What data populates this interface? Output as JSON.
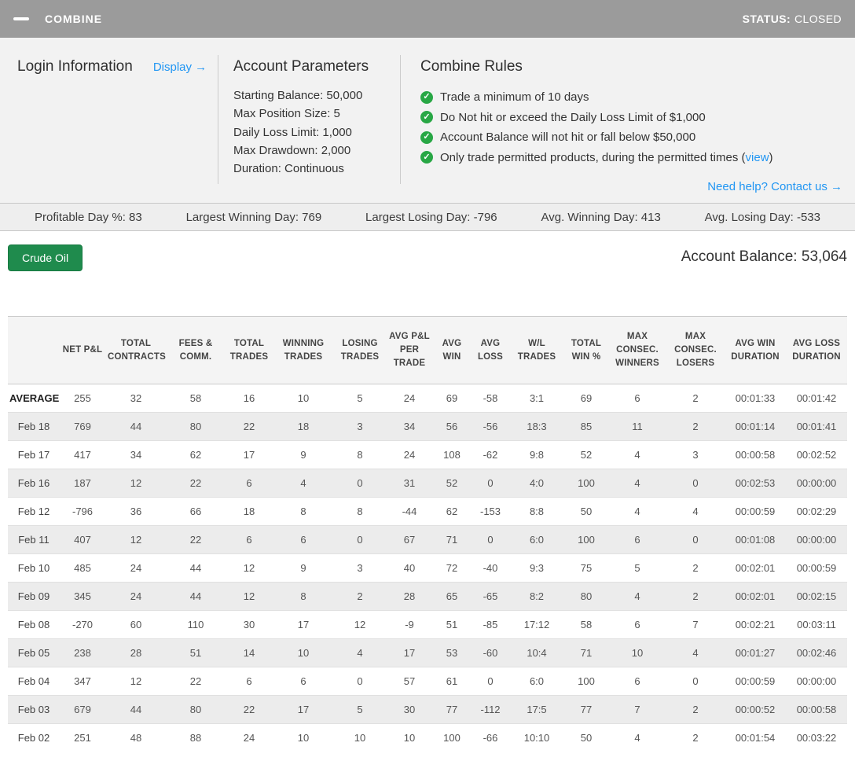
{
  "colors": {
    "topbar_gray": "#9b9b9b",
    "link_blue": "#2196f3",
    "check_green": "#28a745",
    "button_green": "#1f8b4d"
  },
  "header": {
    "title": "COMBINE",
    "status_label": "STATUS:",
    "status_value": "CLOSED"
  },
  "login": {
    "title": "Login Information",
    "display_link": "Display →"
  },
  "account_parameters": {
    "title": "Account Parameters",
    "items": [
      "Starting Balance: 50,000",
      "Max Position Size: 5",
      "Daily Loss Limit: 1,000",
      "Max Drawdown: 2,000",
      "Duration: Continuous"
    ]
  },
  "combine_rules": {
    "title": "Combine Rules",
    "rules": [
      {
        "prefix": "Trade a minimum of 10 days",
        "link": "",
        "suffix": ""
      },
      {
        "prefix": "Do Not hit or exceed the Daily Loss Limit of $1,000",
        "link": "",
        "suffix": ""
      },
      {
        "prefix": "Account Balance will not hit or fall below $50,000",
        "link": "",
        "suffix": ""
      },
      {
        "prefix": "Only trade permitted products, during the permitted times (",
        "link": "view",
        "suffix": ")"
      }
    ],
    "help_link": "Need help? Contact us →"
  },
  "stats_bar": {
    "items": [
      "Profitable Day %: 83",
      "Largest Winning Day: 769",
      "Largest Losing Day: -796",
      "Avg. Winning Day: 413",
      "Avg. Losing Day: -533"
    ]
  },
  "product_button": "Crude Oil",
  "account_balance": {
    "label": "Account Balance:",
    "value": "53,064"
  },
  "table": {
    "columns": [
      "NET P&L",
      "TOTAL CONTRACTS",
      "FEES & COMM.",
      "TOTAL TRADES",
      "WINNING TRADES",
      "LOSING TRADES",
      "AVG P&L PER TRADE",
      "AVG WIN",
      "AVG LOSS",
      "W/L TRADES",
      "TOTAL WIN %",
      "MAX CONSEC. WINNERS",
      "MAX CONSEC. LOSERS",
      "AVG WIN DURATION",
      "AVG LOSS DURATION"
    ],
    "rows": [
      {
        "label": "AVERAGE",
        "bold": true,
        "values": [
          "255",
          "32",
          "58",
          "16",
          "10",
          "5",
          "24",
          "69",
          "-58",
          "3:1",
          "69",
          "6",
          "2",
          "00:01:33",
          "00:01:42"
        ]
      },
      {
        "label": "Feb 18",
        "bold": false,
        "values": [
          "769",
          "44",
          "80",
          "22",
          "18",
          "3",
          "34",
          "56",
          "-56",
          "18:3",
          "85",
          "11",
          "2",
          "00:01:14",
          "00:01:41"
        ]
      },
      {
        "label": "Feb 17",
        "bold": false,
        "values": [
          "417",
          "34",
          "62",
          "17",
          "9",
          "8",
          "24",
          "108",
          "-62",
          "9:8",
          "52",
          "4",
          "3",
          "00:00:58",
          "00:02:52"
        ]
      },
      {
        "label": "Feb 16",
        "bold": false,
        "values": [
          "187",
          "12",
          "22",
          "6",
          "4",
          "0",
          "31",
          "52",
          "0",
          "4:0",
          "100",
          "4",
          "0",
          "00:02:53",
          "00:00:00"
        ]
      },
      {
        "label": "Feb 12",
        "bold": false,
        "values": [
          "-796",
          "36",
          "66",
          "18",
          "8",
          "8",
          "-44",
          "62",
          "-153",
          "8:8",
          "50",
          "4",
          "4",
          "00:00:59",
          "00:02:29"
        ]
      },
      {
        "label": "Feb 11",
        "bold": false,
        "values": [
          "407",
          "12",
          "22",
          "6",
          "6",
          "0",
          "67",
          "71",
          "0",
          "6:0",
          "100",
          "6",
          "0",
          "00:01:08",
          "00:00:00"
        ]
      },
      {
        "label": "Feb 10",
        "bold": false,
        "values": [
          "485",
          "24",
          "44",
          "12",
          "9",
          "3",
          "40",
          "72",
          "-40",
          "9:3",
          "75",
          "5",
          "2",
          "00:02:01",
          "00:00:59"
        ]
      },
      {
        "label": "Feb 09",
        "bold": false,
        "values": [
          "345",
          "24",
          "44",
          "12",
          "8",
          "2",
          "28",
          "65",
          "-65",
          "8:2",
          "80",
          "4",
          "2",
          "00:02:01",
          "00:02:15"
        ]
      },
      {
        "label": "Feb 08",
        "bold": false,
        "values": [
          "-270",
          "60",
          "110",
          "30",
          "17",
          "12",
          "-9",
          "51",
          "-85",
          "17:12",
          "58",
          "6",
          "7",
          "00:02:21",
          "00:03:11"
        ]
      },
      {
        "label": "Feb 05",
        "bold": false,
        "values": [
          "238",
          "28",
          "51",
          "14",
          "10",
          "4",
          "17",
          "53",
          "-60",
          "10:4",
          "71",
          "10",
          "4",
          "00:01:27",
          "00:02:46"
        ]
      },
      {
        "label": "Feb 04",
        "bold": false,
        "values": [
          "347",
          "12",
          "22",
          "6",
          "6",
          "0",
          "57",
          "61",
          "0",
          "6:0",
          "100",
          "6",
          "0",
          "00:00:59",
          "00:00:00"
        ]
      },
      {
        "label": "Feb 03",
        "bold": false,
        "values": [
          "679",
          "44",
          "80",
          "22",
          "17",
          "5",
          "30",
          "77",
          "-112",
          "17:5",
          "77",
          "7",
          "2",
          "00:00:52",
          "00:00:58"
        ]
      },
      {
        "label": "Feb 02",
        "bold": false,
        "values": [
          "251",
          "48",
          "88",
          "24",
          "10",
          "10",
          "10",
          "100",
          "-66",
          "10:10",
          "50",
          "4",
          "2",
          "00:01:54",
          "00:03:22"
        ]
      }
    ]
  }
}
